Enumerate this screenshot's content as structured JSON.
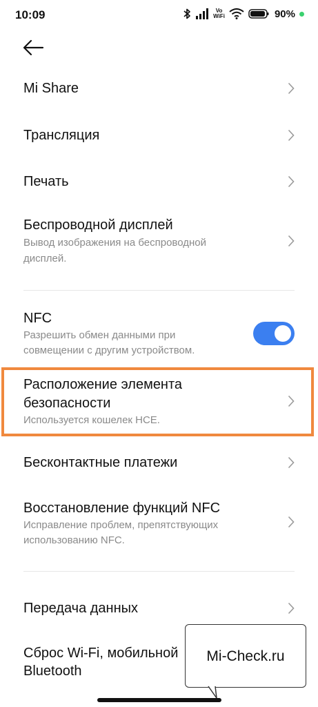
{
  "status_bar": {
    "time": "10:09",
    "volte_top": "Vo",
    "volte_bottom": "WiFi",
    "battery": "90%"
  },
  "items": [
    {
      "title": "Mi Share"
    },
    {
      "title": "Трансляция"
    },
    {
      "title": "Печать"
    },
    {
      "title": "Беспроводной дисплей",
      "sub_line1": "Вывод изображения на беспроводной",
      "sub_line2": "дисплей."
    },
    {
      "title": "NFC",
      "sub_line1": "Разрешить обмен данными при",
      "sub_line2": "совмещении с другим устройством.",
      "toggle_on": true
    },
    {
      "title_line1": "Расположение элемента",
      "title_line2": "безопасности",
      "sub": "Используется кошелек HCE."
    },
    {
      "title": "Бесконтактные платежи"
    },
    {
      "title": "Восстановление функций NFC",
      "sub_line1": "Исправление проблем, препятствующих",
      "sub_line2": "использованию NFC."
    },
    {
      "title": "Передача данных"
    },
    {
      "title_line1": "Сброс Wi-Fi, мобильной",
      "title_line2": "Bluetooth"
    }
  ],
  "watermark": "Mi-Check.ru",
  "colors": {
    "accent": "#3b7ff0",
    "highlight": "#f0893e",
    "battery_dot": "#3bd16f"
  }
}
